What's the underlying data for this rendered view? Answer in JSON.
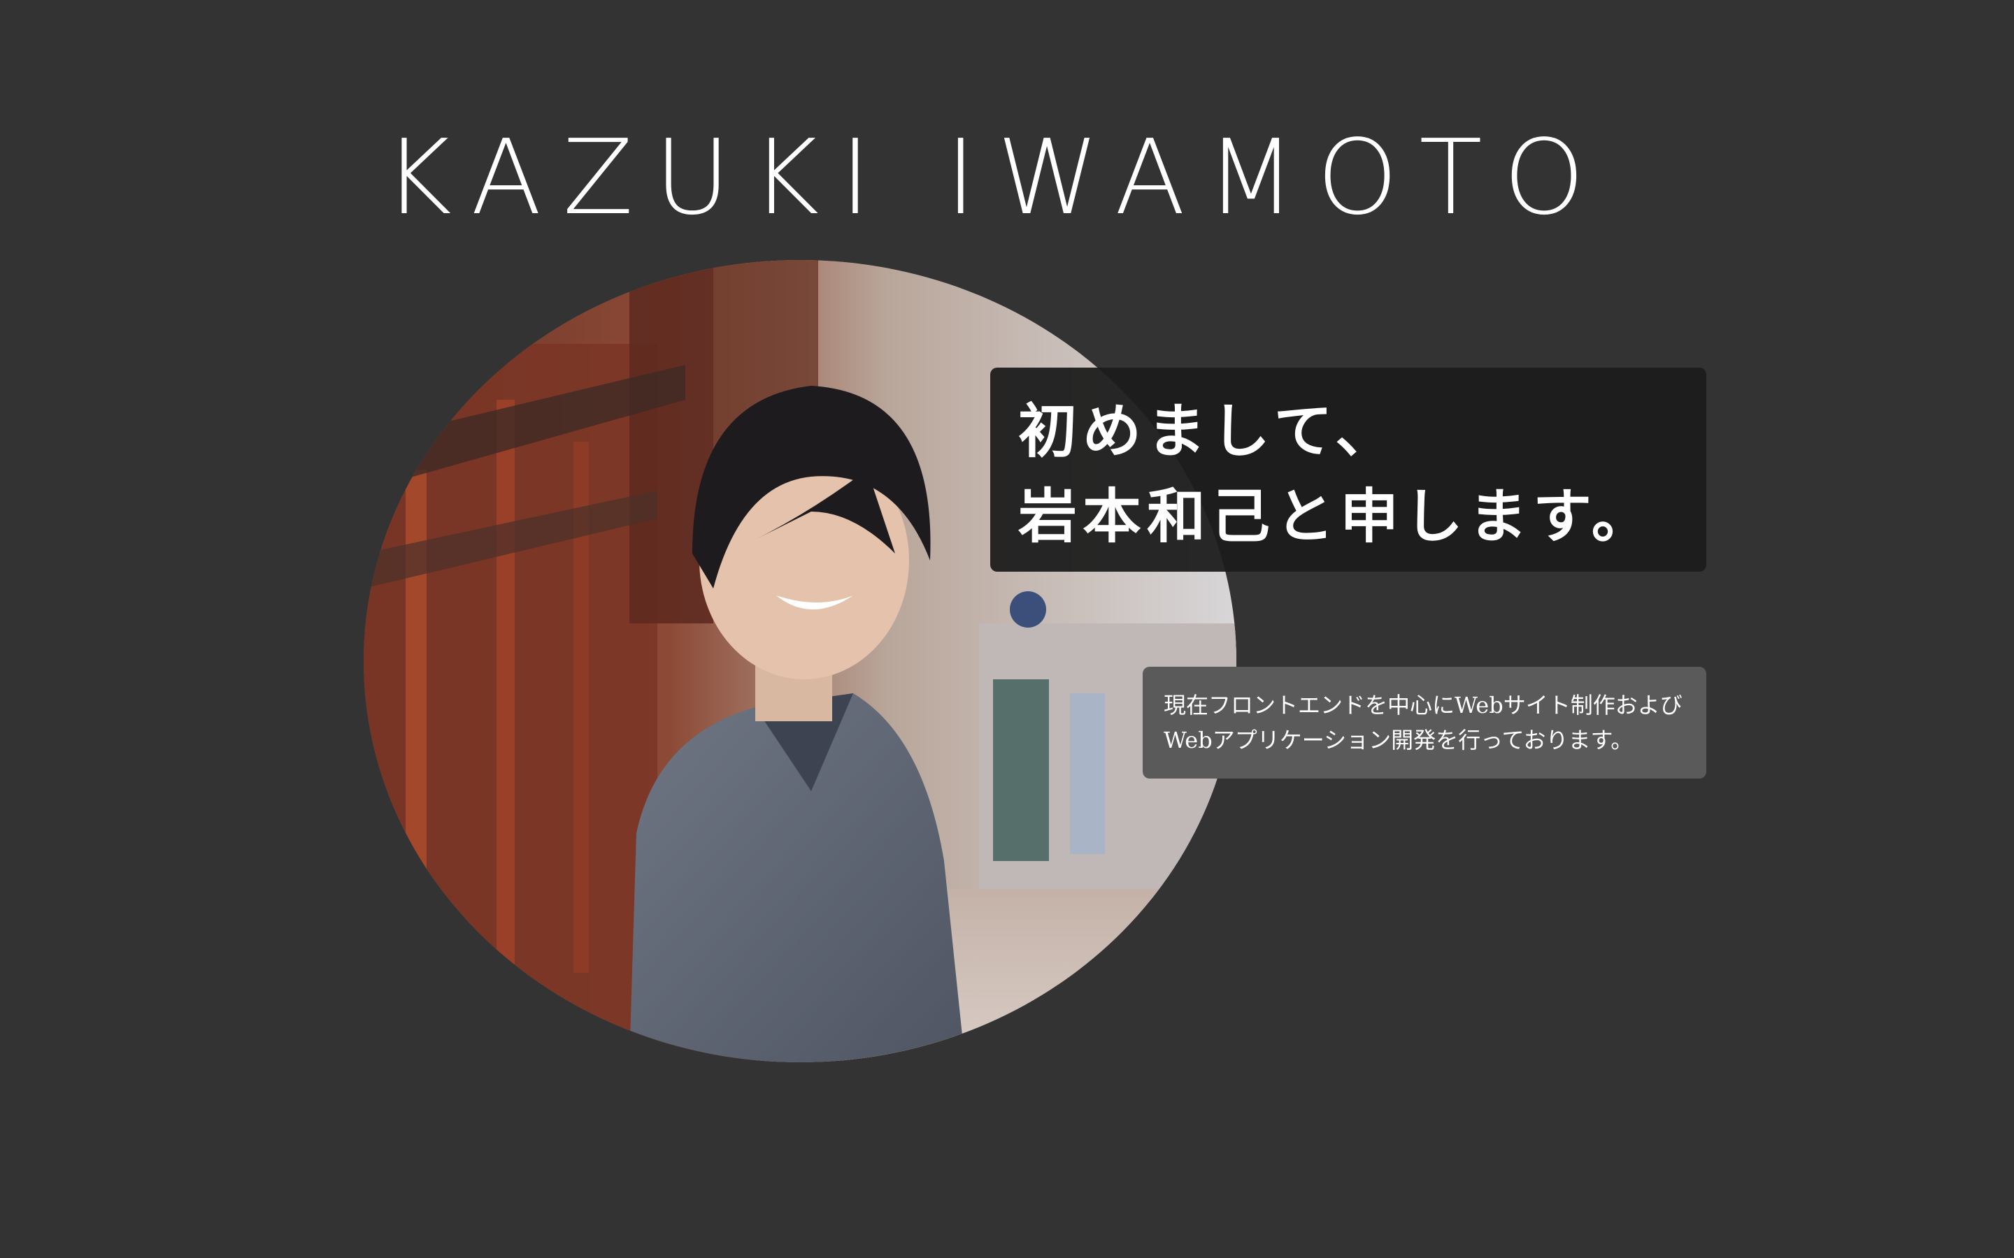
{
  "header": {
    "title": "KAZUKI IWAMOTO"
  },
  "profile": {
    "photo_subject": "portrait-photo",
    "greeting": {
      "line1": "初めまして、",
      "line2": "岩本和己と申します。"
    },
    "intro": {
      "line1": "現在フロントエンドを中心にWebサイト制作および",
      "line2": "Webアプリケーション開発を行っております。"
    }
  },
  "colors": {
    "background": "#333333",
    "greeting_box": "#1c1c1c",
    "intro_box": "#5a5a5a",
    "text": "#ffffff"
  }
}
